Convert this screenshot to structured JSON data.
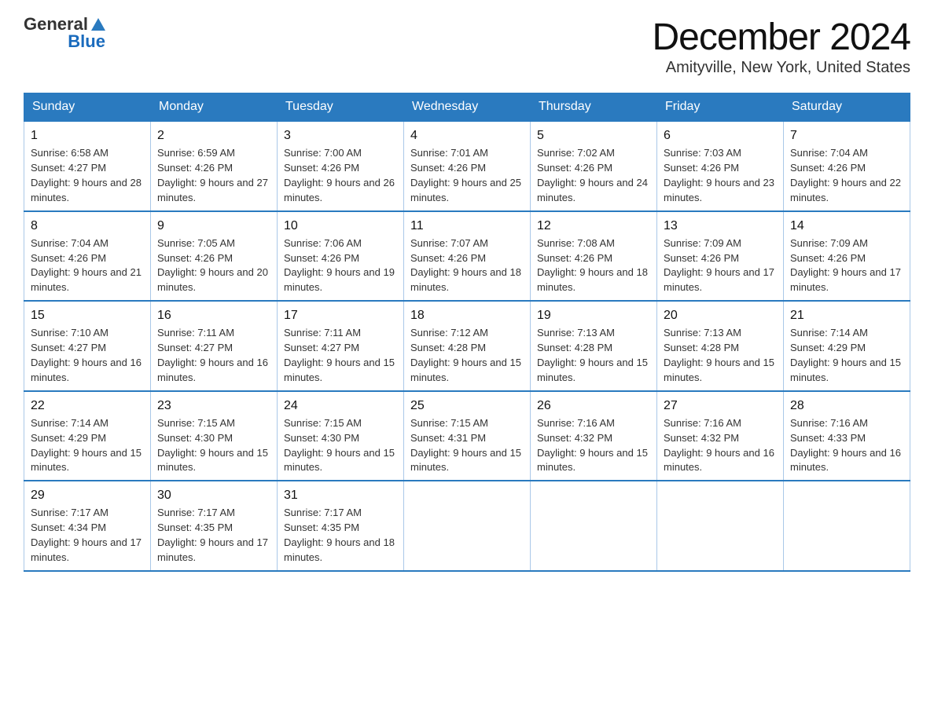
{
  "header": {
    "logo_general": "General",
    "logo_blue": "Blue",
    "month_title": "December 2024",
    "location": "Amityville, New York, United States"
  },
  "days_of_week": [
    "Sunday",
    "Monday",
    "Tuesday",
    "Wednesday",
    "Thursday",
    "Friday",
    "Saturday"
  ],
  "weeks": [
    [
      {
        "day": "1",
        "sunrise": "6:58 AM",
        "sunset": "4:27 PM",
        "daylight": "9 hours and 28 minutes."
      },
      {
        "day": "2",
        "sunrise": "6:59 AM",
        "sunset": "4:26 PM",
        "daylight": "9 hours and 27 minutes."
      },
      {
        "day": "3",
        "sunrise": "7:00 AM",
        "sunset": "4:26 PM",
        "daylight": "9 hours and 26 minutes."
      },
      {
        "day": "4",
        "sunrise": "7:01 AM",
        "sunset": "4:26 PM",
        "daylight": "9 hours and 25 minutes."
      },
      {
        "day": "5",
        "sunrise": "7:02 AM",
        "sunset": "4:26 PM",
        "daylight": "9 hours and 24 minutes."
      },
      {
        "day": "6",
        "sunrise": "7:03 AM",
        "sunset": "4:26 PM",
        "daylight": "9 hours and 23 minutes."
      },
      {
        "day": "7",
        "sunrise": "7:04 AM",
        "sunset": "4:26 PM",
        "daylight": "9 hours and 22 minutes."
      }
    ],
    [
      {
        "day": "8",
        "sunrise": "7:04 AM",
        "sunset": "4:26 PM",
        "daylight": "9 hours and 21 minutes."
      },
      {
        "day": "9",
        "sunrise": "7:05 AM",
        "sunset": "4:26 PM",
        "daylight": "9 hours and 20 minutes."
      },
      {
        "day": "10",
        "sunrise": "7:06 AM",
        "sunset": "4:26 PM",
        "daylight": "9 hours and 19 minutes."
      },
      {
        "day": "11",
        "sunrise": "7:07 AM",
        "sunset": "4:26 PM",
        "daylight": "9 hours and 18 minutes."
      },
      {
        "day": "12",
        "sunrise": "7:08 AM",
        "sunset": "4:26 PM",
        "daylight": "9 hours and 18 minutes."
      },
      {
        "day": "13",
        "sunrise": "7:09 AM",
        "sunset": "4:26 PM",
        "daylight": "9 hours and 17 minutes."
      },
      {
        "day": "14",
        "sunrise": "7:09 AM",
        "sunset": "4:26 PM",
        "daylight": "9 hours and 17 minutes."
      }
    ],
    [
      {
        "day": "15",
        "sunrise": "7:10 AM",
        "sunset": "4:27 PM",
        "daylight": "9 hours and 16 minutes."
      },
      {
        "day": "16",
        "sunrise": "7:11 AM",
        "sunset": "4:27 PM",
        "daylight": "9 hours and 16 minutes."
      },
      {
        "day": "17",
        "sunrise": "7:11 AM",
        "sunset": "4:27 PM",
        "daylight": "9 hours and 15 minutes."
      },
      {
        "day": "18",
        "sunrise": "7:12 AM",
        "sunset": "4:28 PM",
        "daylight": "9 hours and 15 minutes."
      },
      {
        "day": "19",
        "sunrise": "7:13 AM",
        "sunset": "4:28 PM",
        "daylight": "9 hours and 15 minutes."
      },
      {
        "day": "20",
        "sunrise": "7:13 AM",
        "sunset": "4:28 PM",
        "daylight": "9 hours and 15 minutes."
      },
      {
        "day": "21",
        "sunrise": "7:14 AM",
        "sunset": "4:29 PM",
        "daylight": "9 hours and 15 minutes."
      }
    ],
    [
      {
        "day": "22",
        "sunrise": "7:14 AM",
        "sunset": "4:29 PM",
        "daylight": "9 hours and 15 minutes."
      },
      {
        "day": "23",
        "sunrise": "7:15 AM",
        "sunset": "4:30 PM",
        "daylight": "9 hours and 15 minutes."
      },
      {
        "day": "24",
        "sunrise": "7:15 AM",
        "sunset": "4:30 PM",
        "daylight": "9 hours and 15 minutes."
      },
      {
        "day": "25",
        "sunrise": "7:15 AM",
        "sunset": "4:31 PM",
        "daylight": "9 hours and 15 minutes."
      },
      {
        "day": "26",
        "sunrise": "7:16 AM",
        "sunset": "4:32 PM",
        "daylight": "9 hours and 15 minutes."
      },
      {
        "day": "27",
        "sunrise": "7:16 AM",
        "sunset": "4:32 PM",
        "daylight": "9 hours and 16 minutes."
      },
      {
        "day": "28",
        "sunrise": "7:16 AM",
        "sunset": "4:33 PM",
        "daylight": "9 hours and 16 minutes."
      }
    ],
    [
      {
        "day": "29",
        "sunrise": "7:17 AM",
        "sunset": "4:34 PM",
        "daylight": "9 hours and 17 minutes."
      },
      {
        "day": "30",
        "sunrise": "7:17 AM",
        "sunset": "4:35 PM",
        "daylight": "9 hours and 17 minutes."
      },
      {
        "day": "31",
        "sunrise": "7:17 AM",
        "sunset": "4:35 PM",
        "daylight": "9 hours and 18 minutes."
      },
      null,
      null,
      null,
      null
    ]
  ],
  "labels": {
    "sunrise": "Sunrise:",
    "sunset": "Sunset:",
    "daylight": "Daylight:"
  }
}
